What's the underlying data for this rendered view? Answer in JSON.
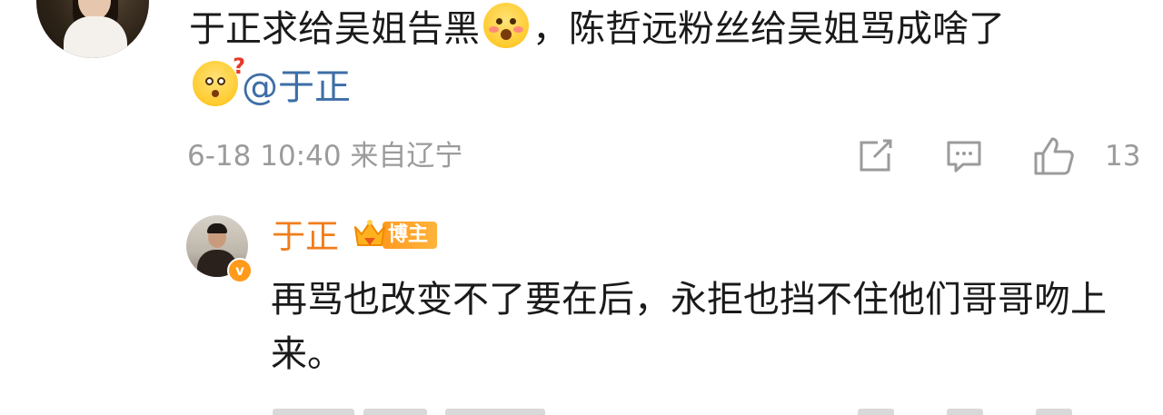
{
  "comment": {
    "text_part1": "于正求给吴姐告黑",
    "emoji1": "smile-blush-emoji",
    "text_part2": "，陈哲远粉丝给吴姐骂成啥了",
    "emoji2": "confused-question-emoji",
    "mention": "@于正",
    "date": "6-18",
    "time": "10:40",
    "location": "来自辽宁",
    "like_count": "13",
    "icons": {
      "share": "share-icon",
      "reply": "comment-icon",
      "like": "thumbs-up-icon"
    }
  },
  "reply": {
    "author": "于正",
    "badge_label": "博主",
    "verified_mark": "v",
    "text": "再骂也改变不了要在后，永拒也挡不住他们哥哥吻上来。"
  },
  "colors": {
    "text": "#1a1a1a",
    "meta": "#9b9b9b",
    "mention": "#3e6ea6",
    "author": "#f07d1b",
    "badge": "#ff9b1f"
  }
}
